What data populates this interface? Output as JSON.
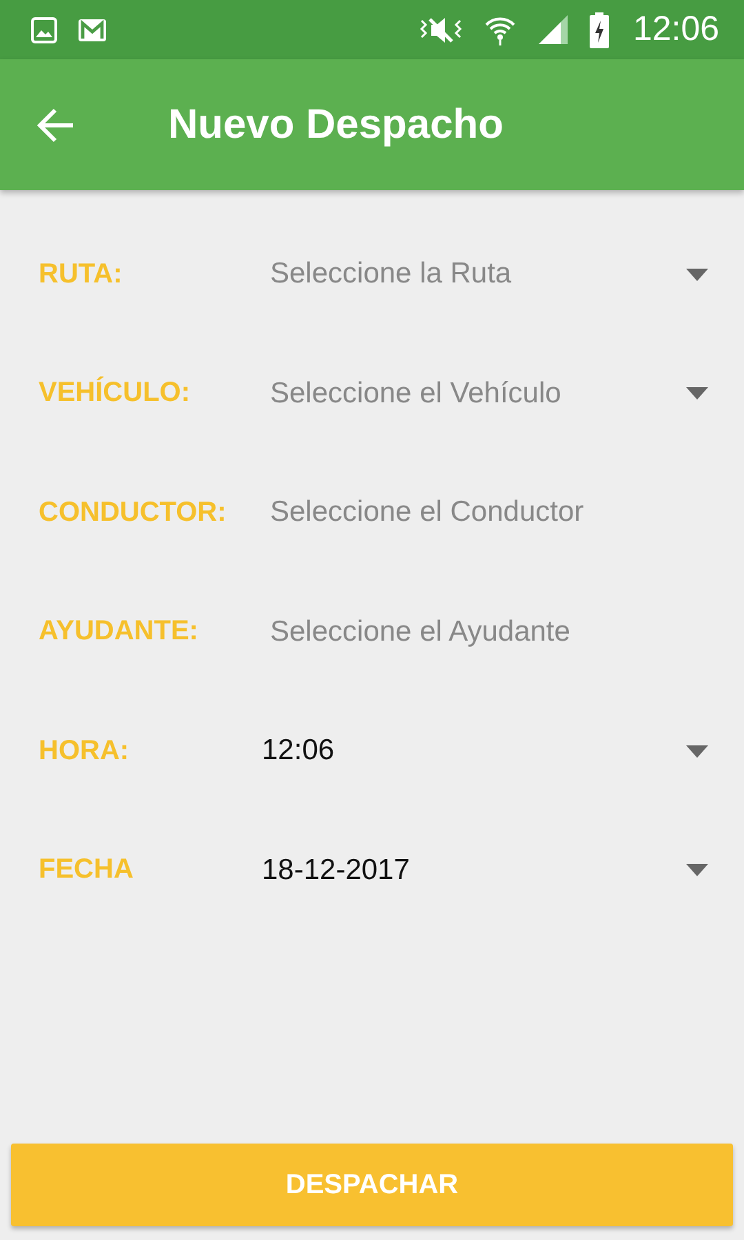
{
  "status_bar": {
    "time": "12:06"
  },
  "toolbar": {
    "title": "Nuevo Despacho"
  },
  "fields": [
    {
      "label": "RUTA:",
      "kind": "dropdown",
      "placeholder": "Seleccione la Ruta"
    },
    {
      "label": "VEHÍCULO:",
      "kind": "dropdown",
      "placeholder": "Seleccione el Vehículo"
    },
    {
      "label": "CONDUCTOR:",
      "kind": "text",
      "placeholder": "Seleccione el Conductor"
    },
    {
      "label": "AYUDANTE:",
      "kind": "text",
      "placeholder": "Seleccione el Ayudante"
    },
    {
      "label": "HORA:",
      "kind": "dropdown",
      "value": "12:06"
    },
    {
      "label": "FECHA",
      "kind": "dropdown",
      "value": "18-12-2017"
    }
  ],
  "button": "DESPACHAR"
}
